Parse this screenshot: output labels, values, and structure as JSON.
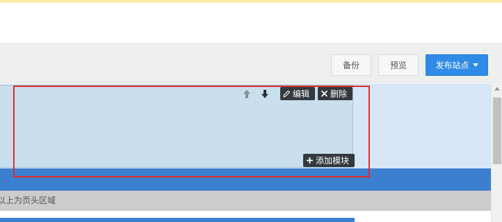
{
  "toolbar": {
    "backup_label": "备份",
    "preview_label": "预览",
    "publish_label": "发布站点"
  },
  "module_actions": {
    "edit_label": "编辑",
    "delete_label": "删除",
    "add_module_label": "添加模块"
  },
  "header_region": {
    "note": "以上为页头区域"
  },
  "colors": {
    "publish_button": "#2f8be6",
    "selection_outline": "#e02a2a",
    "header_band": "#3c7fcf",
    "canvas_background": "#d6e6f7"
  }
}
